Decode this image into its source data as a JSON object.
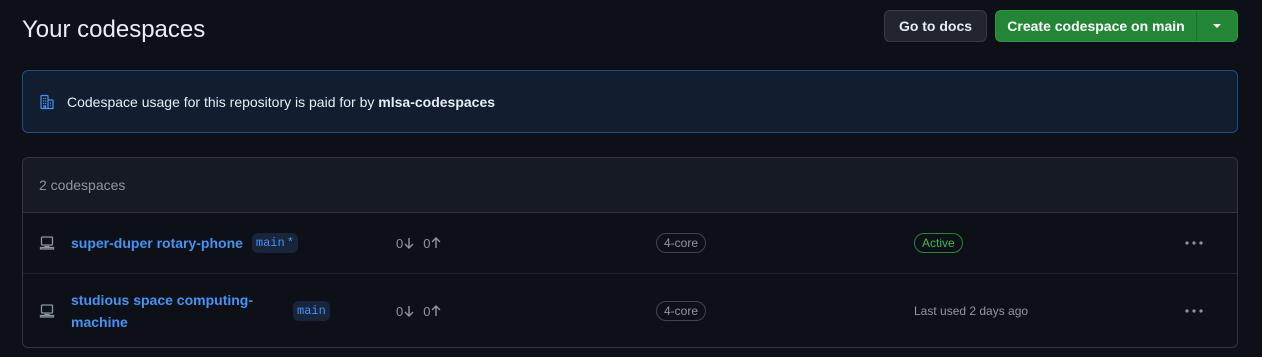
{
  "header": {
    "title": "Your codespaces",
    "docs_label": "Go to docs",
    "create_label": "Create codespace on main"
  },
  "banner": {
    "text_prefix": "Codespace usage for this repository is paid for by",
    "org": "mlsa-codespaces",
    "icon": "organization-icon"
  },
  "list": {
    "count_label": "2 codespaces",
    "rows": [
      {
        "name": "super-duper rotary-phone",
        "branch": "main",
        "branch_marker": "*",
        "behind": "0",
        "ahead": "0",
        "machine": "4-core",
        "status": "Active"
      },
      {
        "name": "studious space computing-machine",
        "branch": "main",
        "behind": "0",
        "ahead": "0",
        "machine": "4-core",
        "status": "Last used 2 days ago"
      }
    ]
  },
  "colors": {
    "background": "#0d1117",
    "primary_button": "#238636",
    "link": "#4493f8",
    "active": "#3fb950",
    "banner_bg": "#121d2f",
    "banner_border": "#1f4d89"
  }
}
